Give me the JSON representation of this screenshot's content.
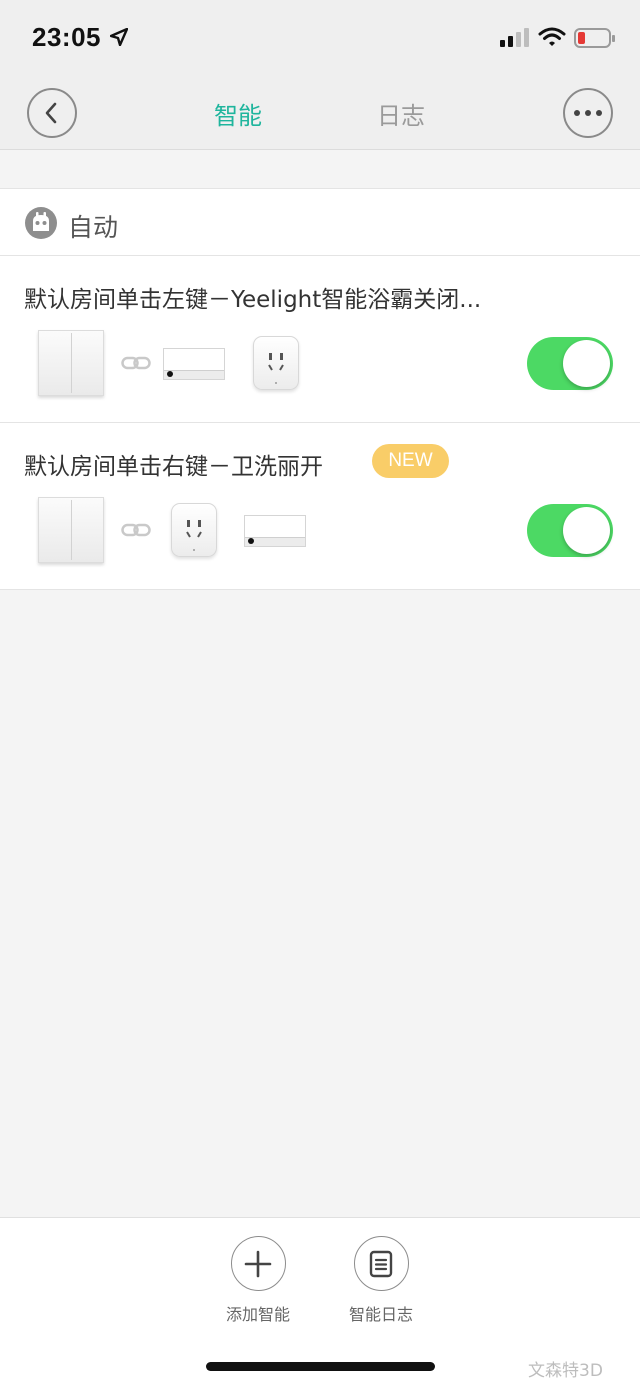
{
  "status_bar": {
    "time": "23:05",
    "location_icon": "location-arrow-icon",
    "signal_icon": "cellular-signal-icon",
    "wifi_icon": "wifi-icon",
    "battery_icon": "battery-low-icon",
    "battery_color": "#e53935"
  },
  "nav": {
    "back_icon": "chevron-left-icon",
    "more_icon": "more-dots-icon",
    "tabs": [
      {
        "label": "智能",
        "active": true
      },
      {
        "label": "日志",
        "active": false
      }
    ],
    "active_color": "#1fb59d"
  },
  "section": {
    "icon": "robot-icon",
    "title": "自动"
  },
  "automations": [
    {
      "title": "默认房间单击左键－Yeelight智能浴霸关闭...",
      "badge": "",
      "devices": [
        "wall-switch-icon",
        "link-icon",
        "light-strip-device-icon",
        "smart-plug-device-icon"
      ],
      "enabled": true
    },
    {
      "title": "默认房间单击右键－卫洗丽开",
      "badge": "NEW",
      "devices": [
        "wall-switch-icon",
        "link-icon",
        "smart-plug-device-icon",
        "light-strip-device-icon"
      ],
      "enabled": true
    }
  ],
  "toggle_color": "#4cd964",
  "bottom": {
    "add_label": "添加智能",
    "add_icon": "plus-icon",
    "log_label": "智能日志",
    "log_icon": "document-icon"
  },
  "watermark": "文森特3D"
}
